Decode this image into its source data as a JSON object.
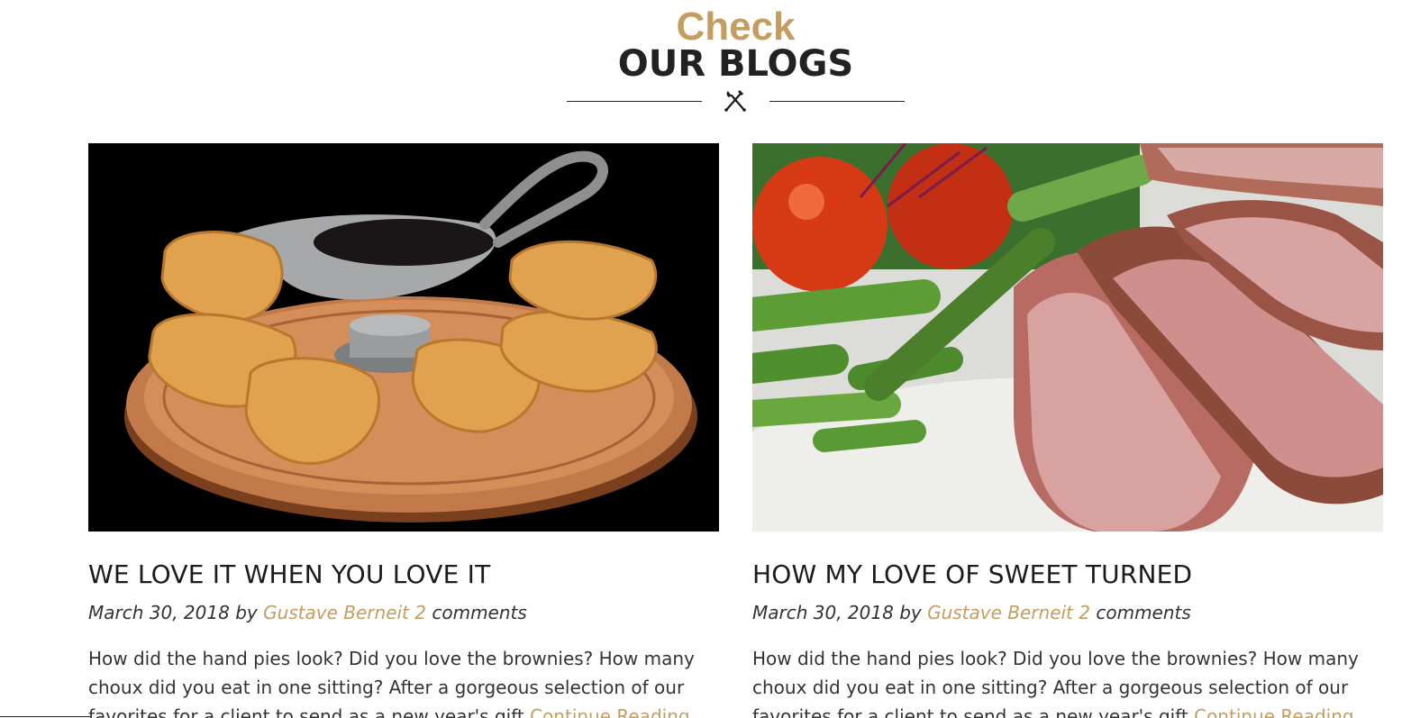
{
  "header": {
    "kicker": "Check",
    "title": "OUR BLOGS",
    "divider_icon": "utensils-crossed-icon"
  },
  "colors": {
    "accent": "#c59d5f",
    "heading": "#222222",
    "text": "#333333"
  },
  "posts": [
    {
      "title": "WE LOVE IT WHEN YOU LOVE IT",
      "date": "March 30, 2018",
      "by": "by",
      "author": "Gustave Berneit",
      "comments_count": "2",
      "comments_label": "comments",
      "excerpt": "How did the hand pies look? Did you love the brownies? How many choux did you eat in one sitting? After a gorgeous selection of our favorites for a client to send as a new year's gift",
      "continue": "Continue Reading",
      "image": "fried-chicken-nuggets-with-gravy-boat"
    },
    {
      "title": "HOW MY LOVE OF SWEET TURNED",
      "date": "March 30, 2018",
      "by": "by",
      "author": "Gustave Berneit",
      "comments_count": "2",
      "comments_label": "comments",
      "excerpt": "How did the hand pies look? Did you love the brownies? How many choux did you eat in one sitting? After a gorgeous selection of our favorites for a client to send as a new year's gift",
      "continue": "Continue Reading",
      "image": "sliced-steak-with-asparagus-and-tomatoes"
    }
  ]
}
